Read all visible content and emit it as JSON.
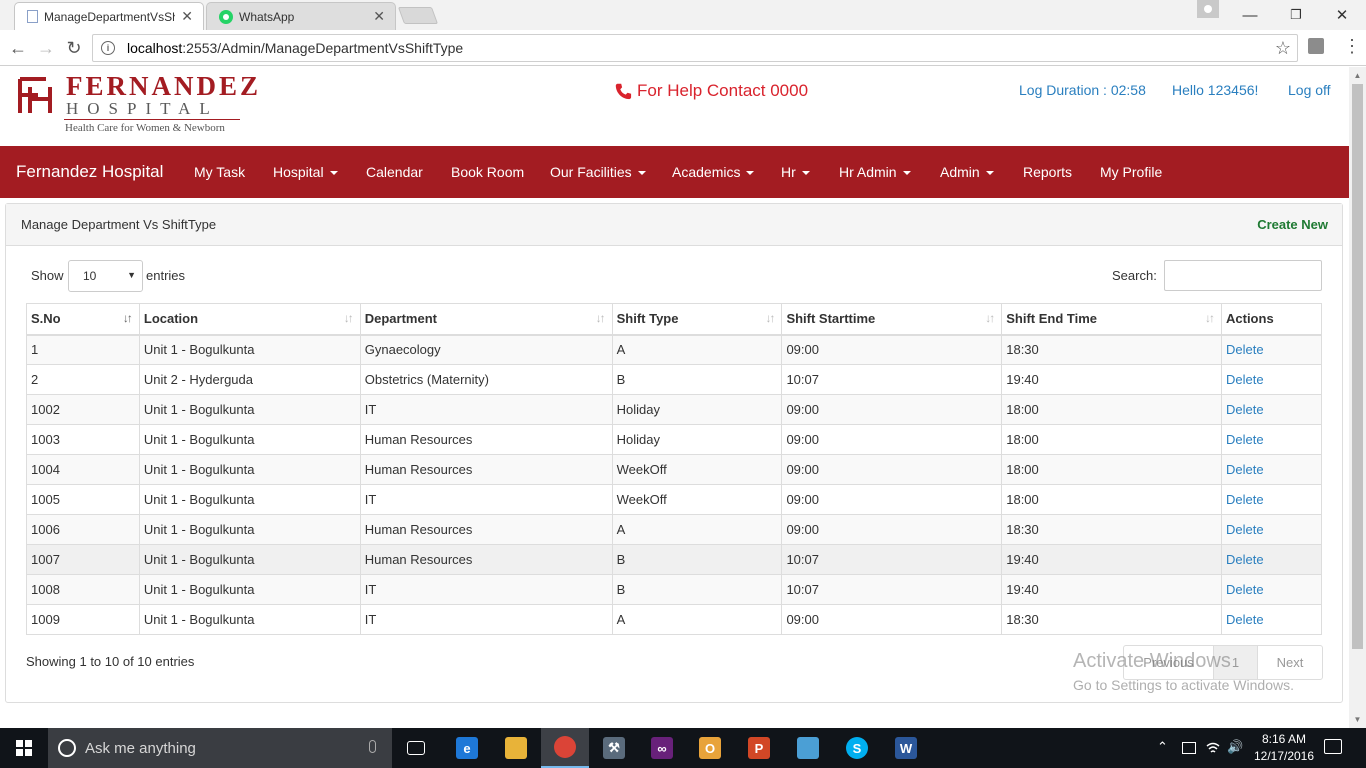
{
  "browser": {
    "tabs": [
      {
        "title": "ManageDepartmentVsSh",
        "close": "✕"
      },
      {
        "title": "WhatsApp",
        "close": "✕"
      }
    ],
    "url_host": "localhost",
    "url_rest": ":2553/Admin/ManageDepartmentVsShiftType",
    "window_controls": {
      "minimize": "—",
      "restore": "❐",
      "close": "✕"
    },
    "nav": {
      "back": "←",
      "forward": "→",
      "reload": "↻",
      "star": "☆",
      "menu": "⋮",
      "info": "i"
    }
  },
  "site": {
    "logo": {
      "name": "FERNANDEZ",
      "sub": "HOSPITAL",
      "tagline": "Health Care for Women & Newborn",
      "brand_color": "#a31c22"
    },
    "help_text": "For Help Contact 0000",
    "log_duration": "Log Duration : 02:58",
    "greeting": "Hello 123456!",
    "logoff": "Log off"
  },
  "navbar": {
    "brand": "Fernandez Hospital",
    "items": [
      {
        "label": "My Task",
        "dropdown": false
      },
      {
        "label": "Hospital",
        "dropdown": true
      },
      {
        "label": "Calendar",
        "dropdown": false
      },
      {
        "label": "Book Room",
        "dropdown": false
      },
      {
        "label": "Our Facilities",
        "dropdown": true
      },
      {
        "label": "Academics",
        "dropdown": true
      },
      {
        "label": "Hr",
        "dropdown": true
      },
      {
        "label": "Hr Admin",
        "dropdown": true
      },
      {
        "label": "Admin",
        "dropdown": true
      },
      {
        "label": "Reports",
        "dropdown": false
      },
      {
        "label": "My Profile",
        "dropdown": false
      }
    ]
  },
  "panel": {
    "title": "Manage Department Vs ShiftType",
    "create_new": "Create New"
  },
  "table_controls": {
    "show": "Show",
    "page_length": "10",
    "page_length_arrow": "▼",
    "entries": "entries",
    "search_label": "Search:",
    "search_value": ""
  },
  "table": {
    "columns": [
      "S.No",
      "Location",
      "Department",
      "Shift Type",
      "Shift Starttime",
      "Shift End Time",
      "Actions"
    ],
    "sort_glyph": "↓↑",
    "rows": [
      [
        "1",
        "Unit 1 - Bogulkunta",
        "Gynaecology",
        "A",
        "09:00",
        "18:30",
        "Delete"
      ],
      [
        "2",
        "Unit 2 - Hyderguda",
        "Obstetrics (Maternity)",
        "B",
        "10:07",
        "19:40",
        "Delete"
      ],
      [
        "1002",
        "Unit 1 - Bogulkunta",
        "IT",
        "Holiday",
        "09:00",
        "18:00",
        "Delete"
      ],
      [
        "1003",
        "Unit 1 - Bogulkunta",
        "Human Resources",
        "Holiday",
        "09:00",
        "18:00",
        "Delete"
      ],
      [
        "1004",
        "Unit 1 - Bogulkunta",
        "Human Resources",
        "WeekOff",
        "09:00",
        "18:00",
        "Delete"
      ],
      [
        "1005",
        "Unit 1 - Bogulkunta",
        "IT",
        "WeekOff",
        "09:00",
        "18:00",
        "Delete"
      ],
      [
        "1006",
        "Unit 1 - Bogulkunta",
        "Human Resources",
        "A",
        "09:00",
        "18:30",
        "Delete"
      ],
      [
        "1007",
        "Unit 1 - Bogulkunta",
        "Human Resources",
        "B",
        "10:07",
        "19:40",
        "Delete"
      ],
      [
        "1008",
        "Unit 1 - Bogulkunta",
        "IT",
        "B",
        "10:07",
        "19:40",
        "Delete"
      ],
      [
        "1009",
        "Unit 1 - Bogulkunta",
        "IT",
        "A",
        "09:00",
        "18:30",
        "Delete"
      ]
    ],
    "info": "Showing 1 to 10 of 10 entries",
    "pager": {
      "previous": "Previous",
      "current": "1",
      "next": "Next"
    }
  },
  "watermark": {
    "line1": "Activate Windows",
    "line2": "Go to Settings to activate Windows."
  },
  "taskbar": {
    "search_placeholder": "Ask me anything",
    "apps": [
      {
        "name": "task-view",
        "glyph": "▭",
        "color": "#101419"
      },
      {
        "name": "edge",
        "glyph": "e",
        "color": "#1e78d7"
      },
      {
        "name": "file-explorer",
        "glyph": "▬",
        "color": "#e8b339"
      },
      {
        "name": "chrome",
        "glyph": "●",
        "color": "#db4437"
      },
      {
        "name": "tools",
        "glyph": "⚒",
        "color": "#5a6b7c"
      },
      {
        "name": "visual-studio",
        "glyph": "∞",
        "color": "#68217a"
      },
      {
        "name": "outlook",
        "glyph": "O",
        "color": "#e8a33a"
      },
      {
        "name": "powerpoint",
        "glyph": "P",
        "color": "#d24726"
      },
      {
        "name": "notes",
        "glyph": "▰",
        "color": "#4b9fd5"
      },
      {
        "name": "skype",
        "glyph": "S",
        "color": "#00aff0"
      },
      {
        "name": "word",
        "glyph": "W",
        "color": "#2b579a"
      }
    ],
    "tray_caret": "⌃",
    "tray_volume": "🔊",
    "time": "8:16 AM",
    "date": "12/17/2016"
  }
}
